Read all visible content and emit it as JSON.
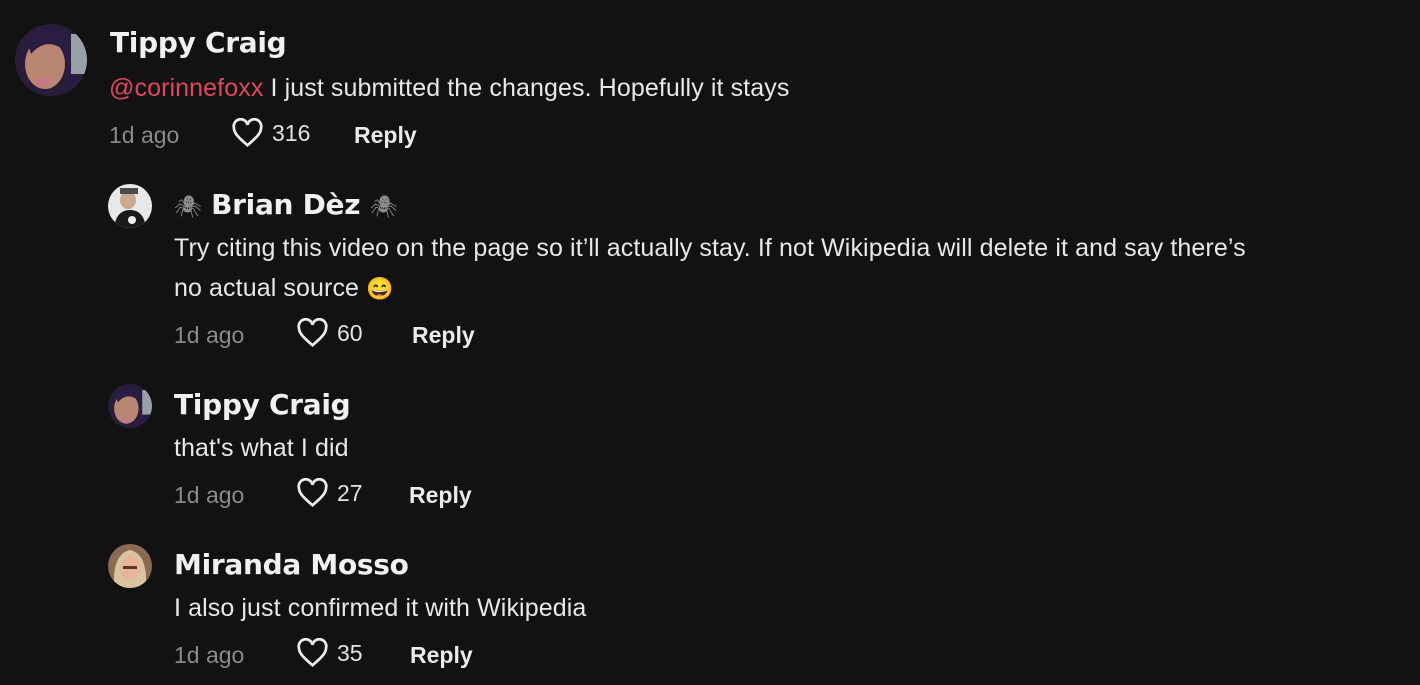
{
  "comments": [
    {
      "author": "Tippy Craig",
      "mention": "@corinnefoxx",
      "text": "I just submitted the changes. Hopefully it stays",
      "time": "1d ago",
      "likes": "316",
      "reply_label": "Reply",
      "avatar": "tippy-craig-avatar"
    },
    {
      "author": "Brian Dèz",
      "author_prefix": "🕷",
      "author_suffix": "🕷",
      "text_line1": "Try citing this video on the page so it’ll actually stay. If not Wikipedia will delete it and say there’s",
      "text_line2": "no actual source",
      "emoji": "😄",
      "time": "1d ago",
      "likes": "60",
      "reply_label": "Reply",
      "avatar": "brian-dez-avatar"
    },
    {
      "author": "Tippy Craig",
      "text": "that's what I did",
      "time": "1d ago",
      "likes": "27",
      "reply_label": "Reply",
      "avatar": "tippy-craig-avatar"
    },
    {
      "author": "Miranda Mosso",
      "text": "I also just confirmed it with Wikipedia",
      "time": "1d ago",
      "likes": "35",
      "reply_label": "Reply",
      "avatar": "miranda-mosso-avatar"
    }
  ],
  "colors": {
    "background": "#121212",
    "mention": "#e0475e",
    "timestamp": "#8a8a8a"
  }
}
